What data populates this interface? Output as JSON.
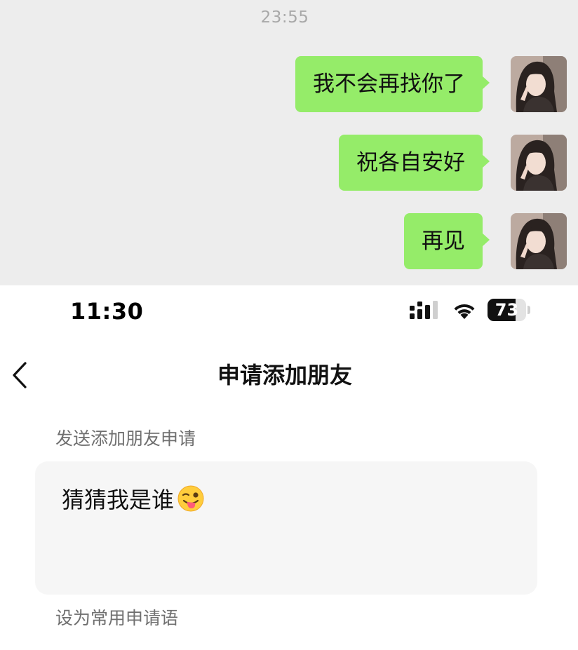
{
  "chat": {
    "timestamp": "23:55",
    "messages": [
      {
        "text": "我不会再找你了"
      },
      {
        "text": "祝各自安好"
      },
      {
        "text": "再见"
      }
    ],
    "bubble_color": "#95ec69",
    "background_color": "#ededed"
  },
  "status_bar": {
    "time": "11:30",
    "battery": "73",
    "battery_level": 0.73,
    "icons": [
      "signal-icon",
      "wifi-icon",
      "battery-icon"
    ]
  },
  "nav": {
    "back_icon": "chevron-left-icon",
    "title": "申请添加朋友"
  },
  "form": {
    "section_label": "发送添加朋友申请",
    "request_message": "猜猜我是谁",
    "request_emoji": "winking-face-with-tongue-icon",
    "set_common_label": "设为常用申请语"
  }
}
